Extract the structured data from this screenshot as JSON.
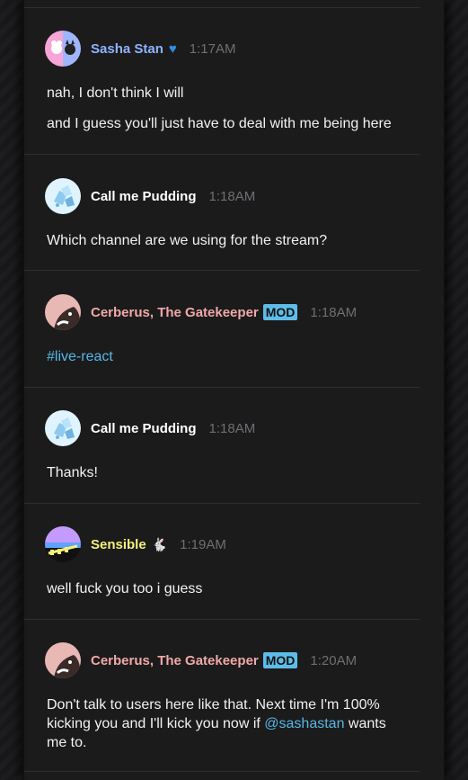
{
  "messages": [
    {
      "author": "Sasha Stan",
      "author_color": "#8fb3ff",
      "icon": "heart-icon",
      "time": "1:17AM",
      "lines": [
        "nah, I don't think I will",
        "and I guess you'll just have to deal with me being here"
      ]
    },
    {
      "author": "Call me Pudding",
      "author_color": "#ffffff",
      "time": "1:18AM",
      "lines": [
        "Which channel are we using for the stream?"
      ]
    },
    {
      "author": "Cerberus, The Gatekeeper",
      "author_color": "#f2a8a8",
      "badge": "MOD",
      "time": "1:18AM",
      "lines": [
        "#live-react"
      ]
    },
    {
      "author": "Call me Pudding",
      "author_color": "#ffffff",
      "time": "1:18AM",
      "lines": [
        "Thanks!"
      ]
    },
    {
      "author": "Sensible",
      "author_color": "#f5f07a",
      "icon": "bunny-icon",
      "time": "1:19AM",
      "lines": [
        "well fuck you too i guess"
      ]
    },
    {
      "author": "Cerberus, The Gatekeeper",
      "author_color": "#f2a8a8",
      "badge": "MOD",
      "time": "1:20AM",
      "text_before": "Don't talk to users here like that. Next time I'm 100% kicking you and I'll kick you now if",
      "mention": "@sashastan",
      "text_after": "wants me to."
    }
  ],
  "colors": {
    "link": "#56b7e6",
    "mod_badge": "#5dbde8",
    "timestamp": "#6f6f73"
  }
}
